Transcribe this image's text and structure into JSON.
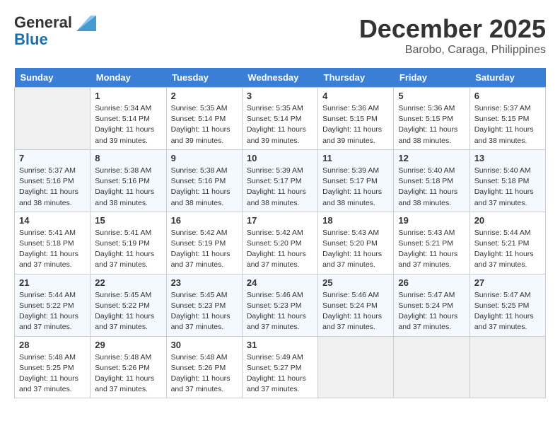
{
  "header": {
    "logo_line1": "General",
    "logo_line2": "Blue",
    "month": "December 2025",
    "location": "Barobo, Caraga, Philippines"
  },
  "days_of_week": [
    "Sunday",
    "Monday",
    "Tuesday",
    "Wednesday",
    "Thursday",
    "Friday",
    "Saturday"
  ],
  "weeks": [
    [
      {
        "day": "",
        "info": ""
      },
      {
        "day": "1",
        "info": "Sunrise: 5:34 AM\nSunset: 5:14 PM\nDaylight: 11 hours\nand 39 minutes."
      },
      {
        "day": "2",
        "info": "Sunrise: 5:35 AM\nSunset: 5:14 PM\nDaylight: 11 hours\nand 39 minutes."
      },
      {
        "day": "3",
        "info": "Sunrise: 5:35 AM\nSunset: 5:14 PM\nDaylight: 11 hours\nand 39 minutes."
      },
      {
        "day": "4",
        "info": "Sunrise: 5:36 AM\nSunset: 5:15 PM\nDaylight: 11 hours\nand 39 minutes."
      },
      {
        "day": "5",
        "info": "Sunrise: 5:36 AM\nSunset: 5:15 PM\nDaylight: 11 hours\nand 38 minutes."
      },
      {
        "day": "6",
        "info": "Sunrise: 5:37 AM\nSunset: 5:15 PM\nDaylight: 11 hours\nand 38 minutes."
      }
    ],
    [
      {
        "day": "7",
        "info": "Sunrise: 5:37 AM\nSunset: 5:16 PM\nDaylight: 11 hours\nand 38 minutes."
      },
      {
        "day": "8",
        "info": "Sunrise: 5:38 AM\nSunset: 5:16 PM\nDaylight: 11 hours\nand 38 minutes."
      },
      {
        "day": "9",
        "info": "Sunrise: 5:38 AM\nSunset: 5:16 PM\nDaylight: 11 hours\nand 38 minutes."
      },
      {
        "day": "10",
        "info": "Sunrise: 5:39 AM\nSunset: 5:17 PM\nDaylight: 11 hours\nand 38 minutes."
      },
      {
        "day": "11",
        "info": "Sunrise: 5:39 AM\nSunset: 5:17 PM\nDaylight: 11 hours\nand 38 minutes."
      },
      {
        "day": "12",
        "info": "Sunrise: 5:40 AM\nSunset: 5:18 PM\nDaylight: 11 hours\nand 38 minutes."
      },
      {
        "day": "13",
        "info": "Sunrise: 5:40 AM\nSunset: 5:18 PM\nDaylight: 11 hours\nand 37 minutes."
      }
    ],
    [
      {
        "day": "14",
        "info": "Sunrise: 5:41 AM\nSunset: 5:18 PM\nDaylight: 11 hours\nand 37 minutes."
      },
      {
        "day": "15",
        "info": "Sunrise: 5:41 AM\nSunset: 5:19 PM\nDaylight: 11 hours\nand 37 minutes."
      },
      {
        "day": "16",
        "info": "Sunrise: 5:42 AM\nSunset: 5:19 PM\nDaylight: 11 hours\nand 37 minutes."
      },
      {
        "day": "17",
        "info": "Sunrise: 5:42 AM\nSunset: 5:20 PM\nDaylight: 11 hours\nand 37 minutes."
      },
      {
        "day": "18",
        "info": "Sunrise: 5:43 AM\nSunset: 5:20 PM\nDaylight: 11 hours\nand 37 minutes."
      },
      {
        "day": "19",
        "info": "Sunrise: 5:43 AM\nSunset: 5:21 PM\nDaylight: 11 hours\nand 37 minutes."
      },
      {
        "day": "20",
        "info": "Sunrise: 5:44 AM\nSunset: 5:21 PM\nDaylight: 11 hours\nand 37 minutes."
      }
    ],
    [
      {
        "day": "21",
        "info": "Sunrise: 5:44 AM\nSunset: 5:22 PM\nDaylight: 11 hours\nand 37 minutes."
      },
      {
        "day": "22",
        "info": "Sunrise: 5:45 AM\nSunset: 5:22 PM\nDaylight: 11 hours\nand 37 minutes."
      },
      {
        "day": "23",
        "info": "Sunrise: 5:45 AM\nSunset: 5:23 PM\nDaylight: 11 hours\nand 37 minutes."
      },
      {
        "day": "24",
        "info": "Sunrise: 5:46 AM\nSunset: 5:23 PM\nDaylight: 11 hours\nand 37 minutes."
      },
      {
        "day": "25",
        "info": "Sunrise: 5:46 AM\nSunset: 5:24 PM\nDaylight: 11 hours\nand 37 minutes."
      },
      {
        "day": "26",
        "info": "Sunrise: 5:47 AM\nSunset: 5:24 PM\nDaylight: 11 hours\nand 37 minutes."
      },
      {
        "day": "27",
        "info": "Sunrise: 5:47 AM\nSunset: 5:25 PM\nDaylight: 11 hours\nand 37 minutes."
      }
    ],
    [
      {
        "day": "28",
        "info": "Sunrise: 5:48 AM\nSunset: 5:25 PM\nDaylight: 11 hours\nand 37 minutes."
      },
      {
        "day": "29",
        "info": "Sunrise: 5:48 AM\nSunset: 5:26 PM\nDaylight: 11 hours\nand 37 minutes."
      },
      {
        "day": "30",
        "info": "Sunrise: 5:48 AM\nSunset: 5:26 PM\nDaylight: 11 hours\nand 37 minutes."
      },
      {
        "day": "31",
        "info": "Sunrise: 5:49 AM\nSunset: 5:27 PM\nDaylight: 11 hours\nand 37 minutes."
      },
      {
        "day": "",
        "info": ""
      },
      {
        "day": "",
        "info": ""
      },
      {
        "day": "",
        "info": ""
      }
    ]
  ]
}
